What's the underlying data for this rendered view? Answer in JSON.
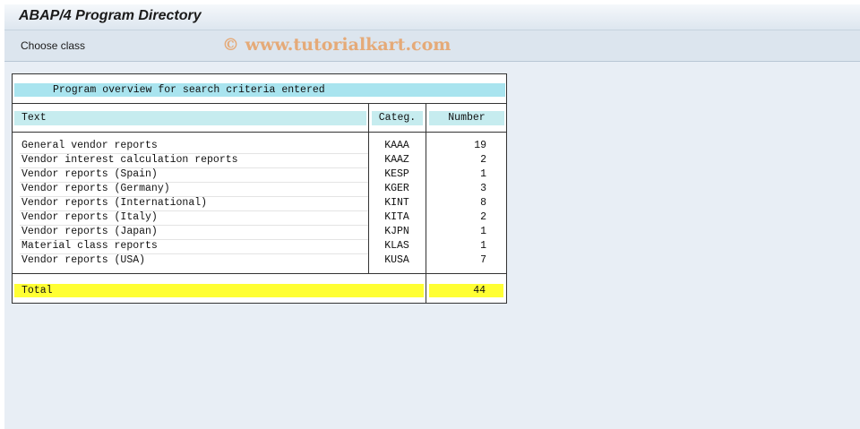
{
  "window": {
    "title": "ABAP/4 Program Directory"
  },
  "toolbar": {
    "choose_class_label": "Choose class"
  },
  "watermark": "© www.tutorialkart.com",
  "report": {
    "header": "Program overview for search criteria entered",
    "columns": {
      "text": "Text",
      "categ": "Categ.",
      "number": "Number"
    },
    "rows": [
      {
        "text": "General vendor reports",
        "categ": "KAAA",
        "number": "19"
      },
      {
        "text": "Vendor interest calculation reports",
        "categ": "KAAZ",
        "number": "2"
      },
      {
        "text": "Vendor reports (Spain)",
        "categ": "KESP",
        "number": "1"
      },
      {
        "text": "Vendor reports (Germany)",
        "categ": "KGER",
        "number": "3"
      },
      {
        "text": "Vendor reports (International)",
        "categ": "KINT",
        "number": "8"
      },
      {
        "text": "Vendor reports (Italy)",
        "categ": "KITA",
        "number": "2"
      },
      {
        "text": "Vendor reports (Japan)",
        "categ": "KJPN",
        "number": "1"
      },
      {
        "text": "Material class reports",
        "categ": "KLAS",
        "number": "1"
      },
      {
        "text": "Vendor reports (USA)",
        "categ": "KUSA",
        "number": "7"
      }
    ],
    "total": {
      "label": "Total",
      "number": "44"
    }
  },
  "colors": {
    "header_band": "#a9e4ef",
    "total_highlight": "#ffff33"
  }
}
